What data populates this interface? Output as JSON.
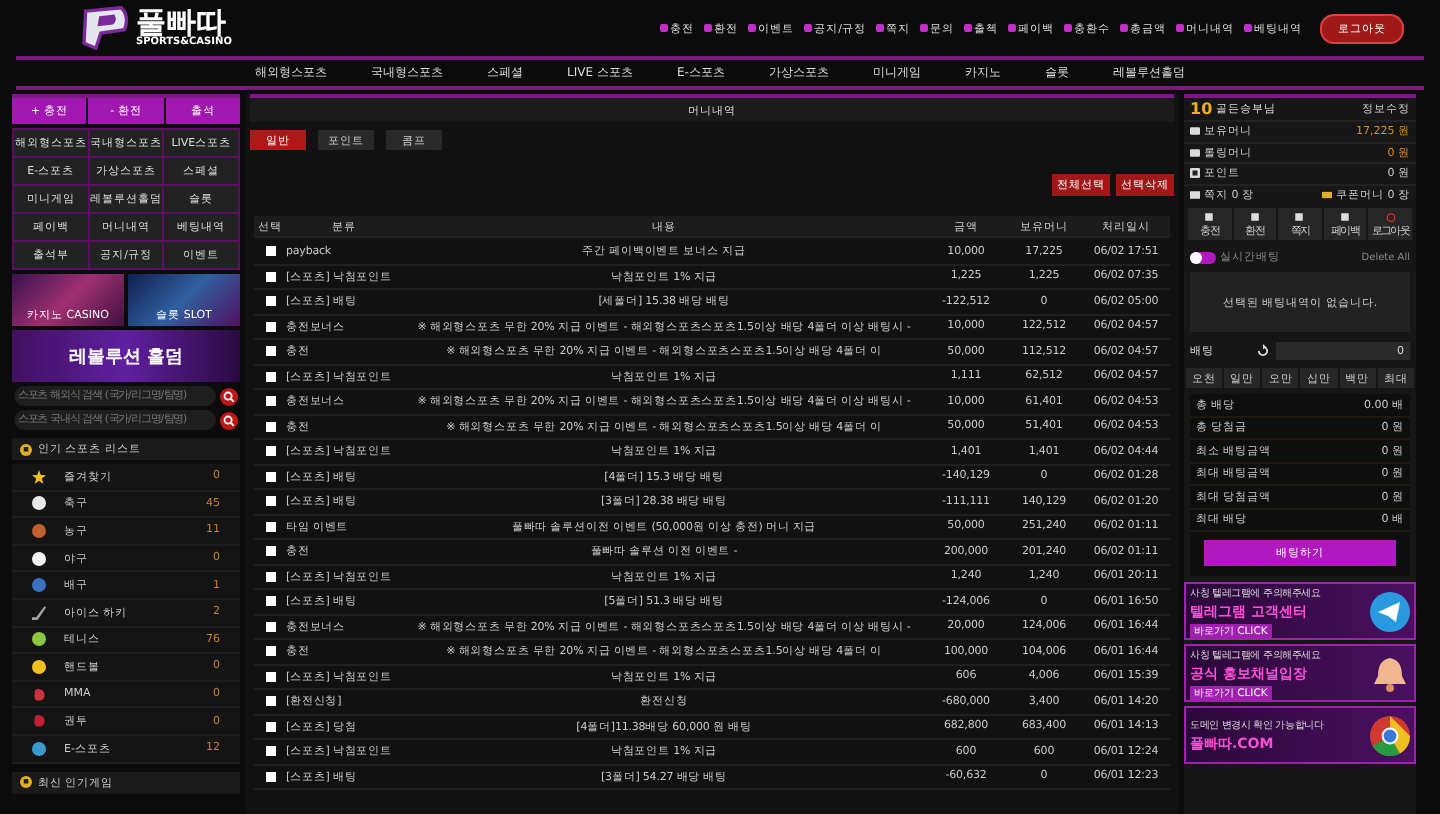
{
  "logo": {
    "title": "풀빠따",
    "subtitle": "SPORTS&CASINO"
  },
  "top_links": [
    "충전",
    "환전",
    "이벤트",
    "공지/규정",
    "쪽지",
    "문의",
    "출첵",
    "페이백",
    "충환수",
    "총금액",
    "머니내역",
    "베팅내역"
  ],
  "logout_button": "로그아웃",
  "main_nav": [
    "해외형스포츠",
    "국내형스포츠",
    "스페셜",
    "LIVE 스포츠",
    "E-스포츠",
    "가상스포츠",
    "미니게임",
    "카지노",
    "슬롯",
    "레볼루션홀덤"
  ],
  "sidebar": {
    "quick_buttons": [
      "+ 충전",
      "- 환전",
      "출석"
    ],
    "menu_grid": [
      "해외형스포츠",
      "국내형스포츠",
      "LIVE스포츠",
      "E-스포츠",
      "가상스포츠",
      "스페셜",
      "미니게임",
      "레볼루션홀덤",
      "슬롯",
      "페이백",
      "머니내역",
      "베팅내역",
      "출석부",
      "공지/규정",
      "이벤트"
    ],
    "banners": [
      {
        "kind": "casino",
        "title": "카지노 CASINO"
      },
      {
        "kind": "slot",
        "title": "슬롯 SLOT"
      },
      {
        "kind": "holdem",
        "title": "레볼루션 홀덤"
      }
    ],
    "search_fields": [
      {
        "placeholder": "스포츠 해외식 검색 (국가/리그명/팀명)"
      },
      {
        "placeholder": "스포츠 국내식 검색 (국가/리그명/팀명)"
      }
    ],
    "sports_title": "인기 스포츠 리스트",
    "sports": [
      {
        "kind": "star",
        "name": "즐겨찾기",
        "count": "0",
        "color": "#f0c020"
      },
      {
        "kind": "ball",
        "name": "축구",
        "count": "45",
        "color": "#e8e8e8"
      },
      {
        "kind": "ball",
        "name": "농구",
        "count": "11",
        "color": "#c0602a"
      },
      {
        "kind": "ball",
        "name": "야구",
        "count": "0",
        "color": "#f4f4f4"
      },
      {
        "kind": "ball",
        "name": "배구",
        "count": "1",
        "color": "#3a70c0"
      },
      {
        "kind": "stick",
        "name": "아이스 하키",
        "count": "2",
        "color": "#a0a0a0"
      },
      {
        "kind": "ball",
        "name": "테니스",
        "count": "76",
        "color": "#8cc63e"
      },
      {
        "kind": "ball",
        "name": "핸드볼",
        "count": "0",
        "color": "#f0c020"
      },
      {
        "kind": "glove",
        "name": "MMA",
        "count": "0",
        "color": "#d03040"
      },
      {
        "kind": "glove",
        "name": "권투",
        "count": "0",
        "color": "#c02030"
      },
      {
        "kind": "ball",
        "name": "E-스포츠",
        "count": "12",
        "color": "#3a9ad0"
      }
    ],
    "latest_title": "최신 인기게임"
  },
  "content": {
    "title": "머니내역",
    "tabs": [
      {
        "label": "일반",
        "selected": true
      },
      {
        "label": "포인트",
        "selected": false
      },
      {
        "label": "콤프",
        "selected": false
      }
    ],
    "actions": [
      "전체선택",
      "선택삭제"
    ],
    "columns": [
      "선택",
      "분류",
      "내용",
      "금액",
      "보유머니",
      "처리일시"
    ],
    "rows": [
      {
        "checked": false,
        "category": "payback",
        "content": "주간 페이백이벤트 보너스 지급",
        "amount": "10,000",
        "balance": "17,225",
        "date": "06/02 17:51"
      },
      {
        "checked": false,
        "category": "[스포츠] 낙첨포인트",
        "content": "낙첨포인트 1% 지급",
        "amount": "1,225",
        "balance": "1,225",
        "date": "06/02 07:35"
      },
      {
        "checked": false,
        "category": "[스포츠] 배팅",
        "content": "[세폴더] 15.38 배당 배팅",
        "amount": "-122,512",
        "balance": "0",
        "date": "06/02 05:00"
      },
      {
        "checked": false,
        "category": "충전보너스",
        "content": "※ 해외형스포츠 무한 20% 지급 이벤트 - 해외형스포츠스포츠1.5이상 배당 4폴더 이상 배팅시 -",
        "amount": "10,000",
        "balance": "122,512",
        "date": "06/02 04:57"
      },
      {
        "checked": false,
        "category": "충전",
        "content": "※ 해외형스포츠 무한 20% 지급 이벤트 - 해외형스포츠스포츠1.5이상 배당 4폴더 이",
        "amount": "50,000",
        "balance": "112,512",
        "date": "06/02 04:57"
      },
      {
        "checked": false,
        "category": "[스포츠] 낙첨포인트",
        "content": "낙첨포인트 1% 지급",
        "amount": "1,111",
        "balance": "62,512",
        "date": "06/02 04:57"
      },
      {
        "checked": false,
        "category": "충전보너스",
        "content": "※ 해외형스포츠 무한 20% 지급 이벤트 - 해외형스포츠스포츠1.5이상 배당 4폴더 이상 배팅시 -",
        "amount": "10,000",
        "balance": "61,401",
        "date": "06/02 04:53"
      },
      {
        "checked": false,
        "category": "충전",
        "content": "※ 해외형스포츠 무한 20% 지급 이벤트 - 해외형스포츠스포츠1.5이상 배당 4폴더 이",
        "amount": "50,000",
        "balance": "51,401",
        "date": "06/02 04:53"
      },
      {
        "checked": false,
        "category": "[스포츠] 낙첨포인트",
        "content": "낙첨포인트 1% 지급",
        "amount": "1,401",
        "balance": "1,401",
        "date": "06/02 04:44"
      },
      {
        "checked": false,
        "category": "[스포츠] 배팅",
        "content": "[4폴더] 15.3 배당 배팅",
        "amount": "-140,129",
        "balance": "0",
        "date": "06/02 01:28"
      },
      {
        "checked": false,
        "category": "[스포츠] 배팅",
        "content": "[3폴더] 28.38 배당 배팅",
        "amount": "-111,111",
        "balance": "140,129",
        "date": "06/02 01:20"
      },
      {
        "checked": false,
        "category": "타임 이벤트",
        "content": "풀빠따 솔루션이전 이벤트 (50,000원 이상 충전) 머니 지급",
        "amount": "50,000",
        "balance": "251,240",
        "date": "06/02 01:11"
      },
      {
        "checked": false,
        "category": "충전",
        "content": "풀빠따 솔루션 이전 이벤트 -",
        "amount": "200,000",
        "balance": "201,240",
        "date": "06/02 01:11"
      },
      {
        "checked": false,
        "category": "[스포츠] 낙첨포인트",
        "content": "낙첨포인트 1% 지급",
        "amount": "1,240",
        "balance": "1,240",
        "date": "06/01 20:11"
      },
      {
        "checked": false,
        "category": "[스포츠] 배팅",
        "content": "[5폴더] 51.3 배당 배팅",
        "amount": "-124,006",
        "balance": "0",
        "date": "06/01 16:50"
      },
      {
        "checked": false,
        "category": "충전보너스",
        "content": "※ 해외형스포츠 무한 20% 지급 이벤트 - 해외형스포츠스포츠1.5이상 배당 4폴더 이상 배팅시 -",
        "amount": "20,000",
        "balance": "124,006",
        "date": "06/01 16:44"
      },
      {
        "checked": false,
        "category": "충전",
        "content": "※ 해외형스포츠 무한 20% 지급 이벤트 - 해외형스포츠스포츠1.5이상 배당 4폴더 이",
        "amount": "100,000",
        "balance": "104,006",
        "date": "06/01 16:44"
      },
      {
        "checked": false,
        "category": "[스포츠] 낙첨포인트",
        "content": "낙첨포인트 1% 지급",
        "amount": "606",
        "balance": "4,006",
        "date": "06/01 15:39"
      },
      {
        "checked": false,
        "category": "[환전신청]",
        "content": "환전신청",
        "amount": "-680,000",
        "balance": "3,400",
        "date": "06/01 14:20"
      },
      {
        "checked": false,
        "category": "[스포츠] 당첨",
        "content": "[4폴더]11.38배당 60,000 원 배팅",
        "amount": "682,800",
        "balance": "683,400",
        "date": "06/01 14:13"
      },
      {
        "checked": false,
        "category": "[스포츠] 낙첨포인트",
        "content": "낙첨포인트 1% 지급",
        "amount": "600",
        "balance": "600",
        "date": "06/01 12:24"
      },
      {
        "checked": false,
        "category": "[스포츠] 배팅",
        "content": "[3폴더] 54.27 배당 배팅",
        "amount": "-60,632",
        "balance": "0",
        "date": "06/01 12:23"
      }
    ]
  },
  "account": {
    "level": "10",
    "nickname": "골든승부님",
    "edit_link": "정보수정",
    "info": [
      {
        "kind": "money",
        "label": "보유머니",
        "value": "17,225 원"
      },
      {
        "kind": "money",
        "label": "롤링머니",
        "value": "0 원"
      },
      {
        "kind": "point",
        "label": "포인트",
        "value": "0 원"
      }
    ],
    "note": {
      "label": "쪽지 0 장",
      "coupon": "쿠폰머니 0 장"
    },
    "buttons": [
      "충전",
      "환전",
      "쪽지",
      "페이백",
      "로그아웃"
    ],
    "toggle": {
      "label": "실시간배팅",
      "on": true
    },
    "delete_all": "Delete All",
    "empty_message": "선택된 배팅내역이 없습니다.",
    "bet_label": "배팅",
    "bet_value": "0",
    "chips": [
      "오천",
      "일만",
      "오만",
      "십만",
      "백만",
      "최대"
    ],
    "summary": [
      {
        "label": "총 배당",
        "value": "0.00 배"
      },
      {
        "label": "총 당첨금",
        "value": "0 원"
      },
      {
        "label": "최소 배팅금액",
        "value": "0 원"
      },
      {
        "label": "최대 배팅금액",
        "value": "0 원"
      },
      {
        "label": "최대 당첨금액",
        "value": "0 원"
      },
      {
        "label": "최대 배당",
        "value": "0 배"
      }
    ],
    "bet_button": "배팅하기",
    "banners": [
      {
        "kind": "telegram",
        "note": "사칭 텔레그램에 주의해주세요",
        "title": "텔레그램 고객센터",
        "cta": "바로가기 CLICK"
      },
      {
        "kind": "bell",
        "note": "사칭 텔레그램에 주의해주세요",
        "title": "공식 홍보채널입장",
        "cta": "바로가기 CLICK"
      },
      {
        "kind": "browser",
        "note": "도메인 변경시 확인 가능합니다",
        "title": "풀빠따.COM"
      }
    ]
  }
}
